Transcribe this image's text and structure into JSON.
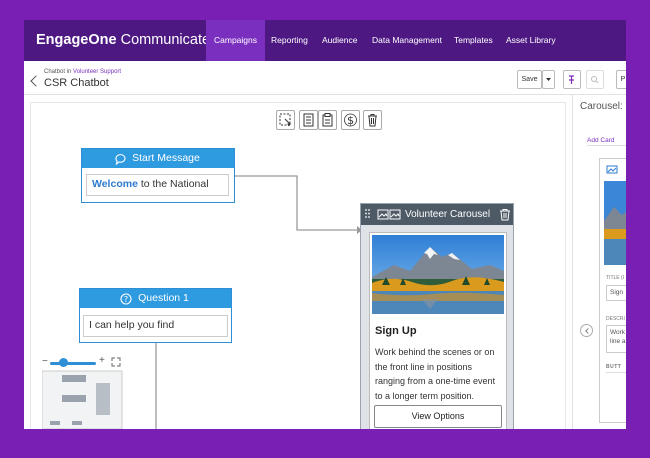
{
  "app": {
    "brand_bold": "EngageOne",
    "brand_rest": " Communicate"
  },
  "nav": {
    "items": [
      {
        "label": "Campaigns",
        "active": true
      },
      {
        "label": "Reporting"
      },
      {
        "label": "Audience"
      },
      {
        "label": "Data Management"
      },
      {
        "label": "Templates"
      },
      {
        "label": "Asset Library"
      }
    ]
  },
  "header": {
    "breadcrumb_prefix": "Chatbot in ",
    "breadcrumb_link": "Volunteer Support",
    "title": "CSR Chatbot",
    "save_label": "Save",
    "partial_button_label": "P"
  },
  "canvas": {
    "toolbar_icons": [
      "select-area-icon",
      "document-icon",
      "clipboard-icon",
      "dollar-icon",
      "trash-icon"
    ],
    "start_node": {
      "title": "Start Message",
      "body_bold": "Welcome",
      "body_rest": " to the National"
    },
    "question_node": {
      "title": "Question 1",
      "body": "I can help you find"
    },
    "carousel": {
      "title": "Volunteer Carousel",
      "card": {
        "title": "Sign Up",
        "description": "Work behind the scenes or on the front line in positions ranging from a one-time event to a longer term position.",
        "button": "View Options"
      }
    },
    "zoom": {
      "minus": "−",
      "plus": "+",
      "level": 0.2
    }
  },
  "right_panel": {
    "title": "Carousel: V",
    "add_card": "Add Card",
    "title_label": "TITLE (I",
    "title_value": "Sign",
    "desc_label": "DESCRI",
    "desc_line1": "Work",
    "desc_line2": "line a",
    "buttons_label": "BUTT"
  },
  "colors": {
    "frame_purple": "#7a1fb3",
    "nav_purple": "#4e1883",
    "nav_active": "#7b2fbf",
    "node_blue": "#2e9ae0",
    "carousel_header": "#4e5a66"
  }
}
